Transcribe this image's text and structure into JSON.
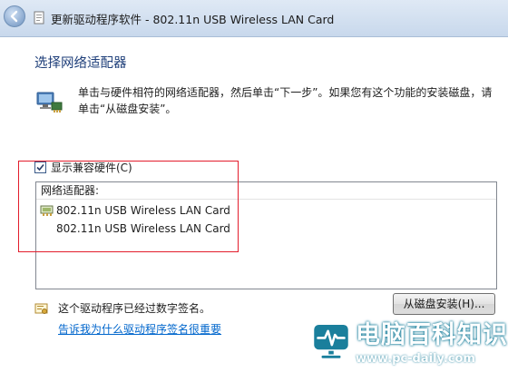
{
  "window": {
    "title": "更新驱动程序软件 - 802.11n USB Wireless LAN Card"
  },
  "dialog": {
    "heading": "选择网络适配器",
    "instruction": "单击与硬件相符的网络适配器，然后单击“下一步”。如果您有这个功能的安装磁盘，请单击“从磁盘安装”。",
    "show_compatible_label": "显示兼容硬件(C)",
    "show_compatible_checked": true,
    "list_header": "网络适配器:",
    "adapters": [
      "802.11n USB Wireless LAN Card",
      "802.11n USB Wireless LAN Card"
    ],
    "signed_text": "这个驱动程序已经过数字签名。",
    "signed_link": "告诉我为什么驱动程序签名很重要",
    "have_disk_button": "从磁盘安装(H)..."
  },
  "watermark": {
    "name": "电脑百科知识",
    "url": "www.pc-daily.com"
  },
  "colors": {
    "heading": "#1f3f7a",
    "link": "#0066cc",
    "highlight": "#e31d2c",
    "watermark": "#1a7f9c"
  },
  "icons": [
    "back-arrow-icon",
    "driver-update-icon",
    "network-adapter-icon",
    "check-icon",
    "adapter-icon",
    "certificate-icon",
    "monitor-logo-icon"
  ]
}
